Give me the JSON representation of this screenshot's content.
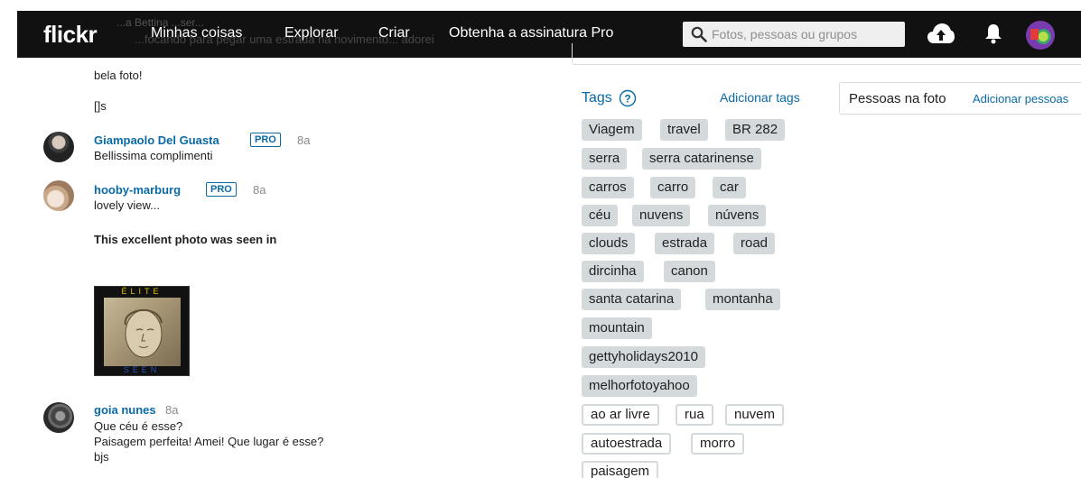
{
  "nav": {
    "logo": "flickr",
    "items": [
      "Minhas coisas",
      "Explorar",
      "Criar",
      "Obtenha a assinatura Pro"
    ],
    "search_placeholder": "Fotos, pessoas ou grupos",
    "ghost_line_1": "...a Bettina  ...ser...",
    "ghost_line_2": "...focando para pegar uma estrada na novimento... adorei",
    "bg_color": "#111111"
  },
  "comments": {
    "prev_text": "bela foto!",
    "prev_sign": "[]s",
    "items": [
      {
        "name": "Giampaolo Del Guasta",
        "badge": "PRO",
        "age": "8a",
        "text": "Bellissima complimenti"
      },
      {
        "name": "hooby-marburg",
        "badge": "PRO",
        "age": "8a",
        "text": "lovely view..."
      }
    ],
    "seen_in": "This excellent photo was seen in",
    "award": {
      "top": "ÉLITE",
      "bottom": "SEEN"
    },
    "last": {
      "name": "goia nunes",
      "age": "8a",
      "lines": [
        "Que céu é esse?",
        "Paisagem perfeita! Amei! Que lugar é esse?",
        "bjs"
      ]
    }
  },
  "tags": {
    "title": "Tags",
    "add_label": "Adicionar tags",
    "filled": [
      "Viagem",
      "travel",
      "BR 282",
      "serra",
      "serra catarinense",
      "carros",
      "carro",
      "car",
      "céu",
      "nuvens",
      "núvens",
      "clouds",
      "estrada",
      "road",
      "dircinha",
      "canon",
      "santa catarina",
      "montanha",
      "mountain",
      "gettyholidays2010",
      "melhorfotoyahoo"
    ],
    "outlined": [
      "ao ar livre",
      "rua",
      "nuvem",
      "autoestrada",
      "morro",
      "paisagem"
    ],
    "fill_color": "#d4dadc"
  },
  "people": {
    "label": "Pessoas na foto",
    "add_label": "Adicionar pessoas"
  },
  "colors": {
    "link": "#0a6aa6"
  }
}
